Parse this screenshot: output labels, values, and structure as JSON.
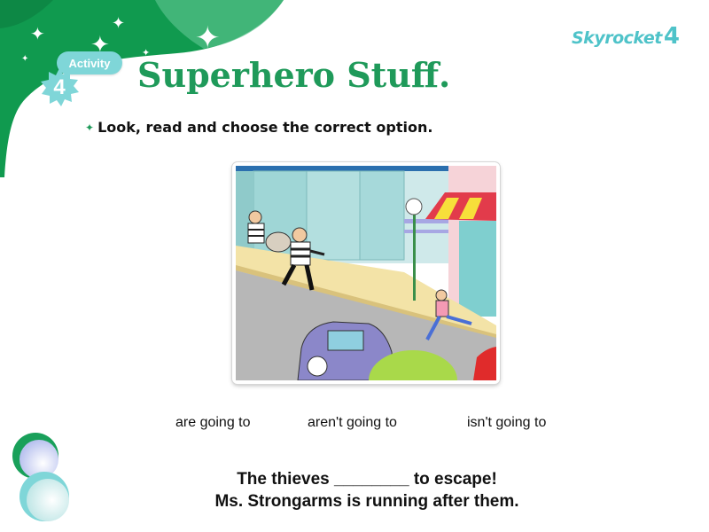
{
  "activity": {
    "label": "Activity",
    "number": "4"
  },
  "title": "Superhero Stuff.",
  "logo": {
    "text": "Skyrocket",
    "number": "4"
  },
  "instruction": "Look, read and choose the correct option.",
  "options": [
    {
      "label": "are going to"
    },
    {
      "label": "aren't going to"
    },
    {
      "label": "isn't going to"
    }
  ],
  "sentence": {
    "line1": "The thieves ________ to escape!",
    "line2": "Ms. Strongarms is running after them."
  },
  "colors": {
    "brand_green": "#1f9a5a",
    "teal": "#7fd6d8",
    "logo": "#4fc3c9"
  },
  "icons": [
    "sparkle-icon",
    "star-bullet-icon"
  ]
}
